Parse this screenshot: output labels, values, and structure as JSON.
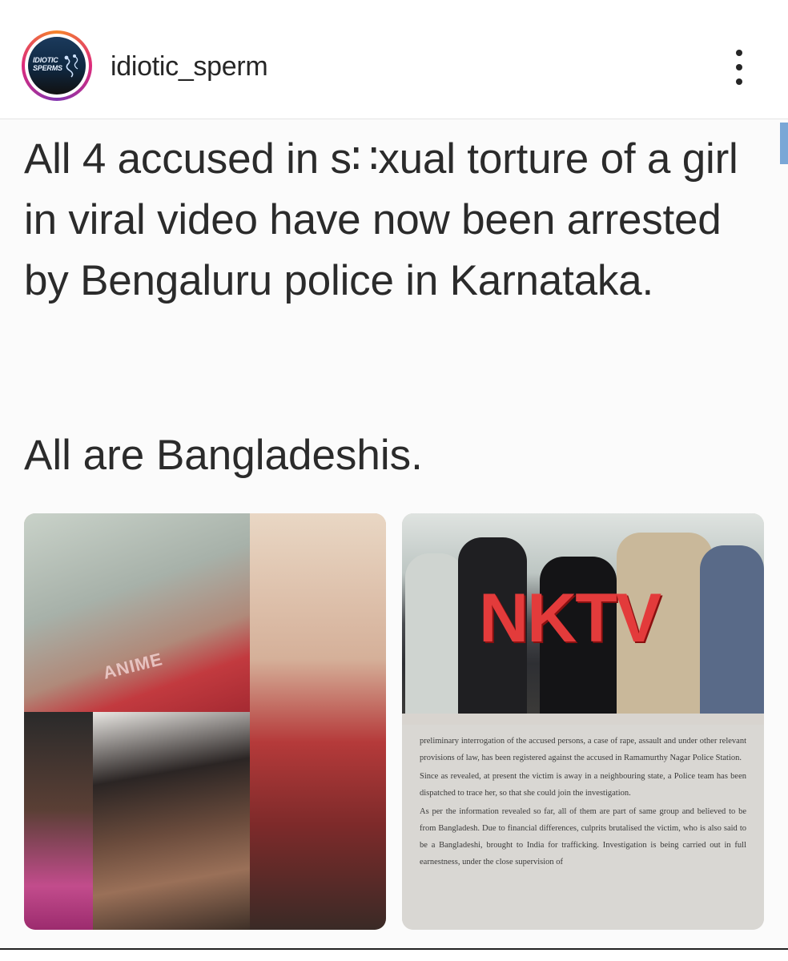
{
  "post": {
    "username": "idiotic_sperm",
    "avatar_text": "IDIOTIC SPERMS",
    "more_icon": "more-vertical-icon"
  },
  "image": {
    "headline": "All 4 accused in s∷xual torture of a girl in viral video have now been arrested by Bengaluru police in Karnataka.",
    "subline": "All are Bangladeshis.",
    "watermark": "NKTV",
    "shirt_text": "ANIME",
    "document_paragraphs": [
      "preliminary interrogation of the accused persons, a case of rape, assault and under other relevant provisions of law, has been registered against the accused in Ramamurthy Nagar Police Station.",
      "Since as revealed, at present the victim is away in a neighbouring state, a Police team has been dispatched to trace her, so that she could join the investigation.",
      "As per the information revealed so far, all of them are part of same group and believed to be from Bangladesh. Due to financial differences, culprits brutalised the victim, who is also said to be a Bangladeshi, brought to India for trafficking. Investigation is being carried out in full earnestness, under the close supervision of"
    ]
  },
  "colors": {
    "ring_start": "#f58529",
    "ring_mid": "#dd2a7b",
    "watermark": "#e33b3b",
    "text": "#262626"
  }
}
